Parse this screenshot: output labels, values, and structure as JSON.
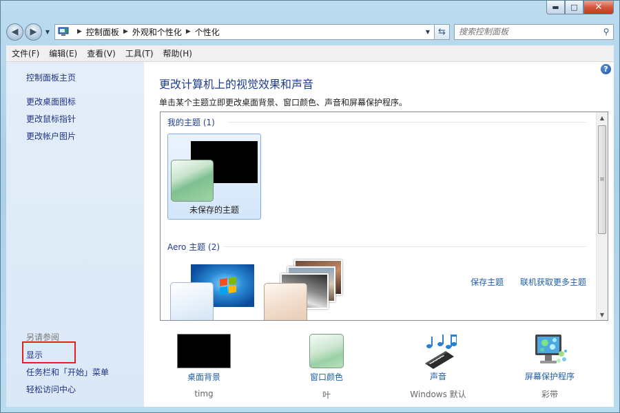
{
  "window": {
    "caption_buttons": {
      "minimize": "▬",
      "maximize": "□",
      "close": "✕"
    }
  },
  "address_bar": {
    "breadcrumbs": [
      "控制面板",
      "外观和个性化",
      "个性化"
    ],
    "search_placeholder": "搜索控制面板"
  },
  "menu": {
    "items": [
      "文件(F)",
      "编辑(E)",
      "查看(V)",
      "工具(T)",
      "帮助(H)"
    ]
  },
  "sidebar": {
    "home": "控制面板主页",
    "links": [
      "更改桌面图标",
      "更改鼠标指针",
      "更改帐户图片"
    ],
    "see_also_heading": "另请参阅",
    "see_also": [
      "显示",
      "任务栏和「开始」菜单",
      "轻松访问中心"
    ]
  },
  "main": {
    "title": "更改计算机上的视觉效果和声音",
    "subtitle": "单击某个主题立即更改桌面背景、窗口颜色、声音和屏幕保护程序。",
    "my_themes_header": "我的主题 (1)",
    "unsaved_theme_label": "未保存的主题",
    "save_theme": "保存主题",
    "get_more_online": "联机获取更多主题",
    "aero_themes_header": "Aero 主题 (2)"
  },
  "bottom_items": [
    {
      "title": "桌面背景",
      "sub": "timg"
    },
    {
      "title": "窗口颜色",
      "sub": "叶"
    },
    {
      "title": "声音",
      "sub": "Windows 默认"
    },
    {
      "title": "屏幕保护程序",
      "sub": "彩带"
    }
  ],
  "colors": {
    "link": "#1e5eaa",
    "heading": "#1e3d8f",
    "highlight_box": "#e0201a",
    "sidebar_bg": "#dbe8f6"
  }
}
